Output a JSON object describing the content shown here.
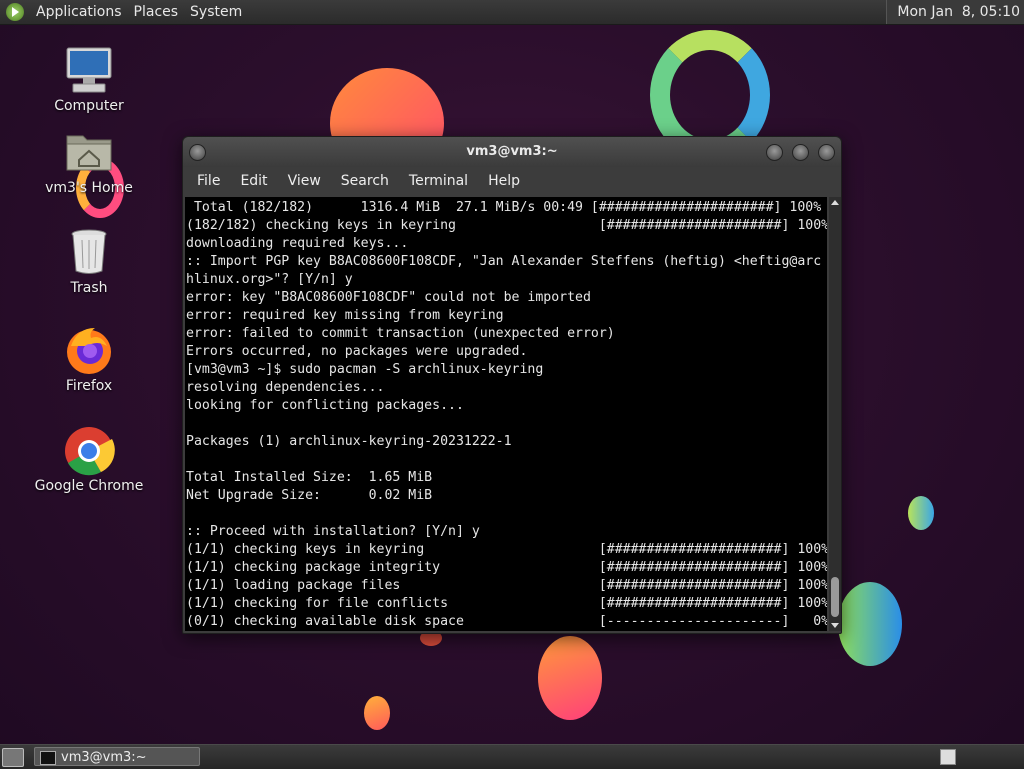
{
  "top_panel": {
    "menus": [
      "Applications",
      "Places",
      "System"
    ],
    "clock": "Mon Jan  8, 05:10"
  },
  "desktop_icons": [
    {
      "label": "Computer",
      "icon": "computer-icon"
    },
    {
      "label": "vm3's Home",
      "icon": "home-folder-icon"
    },
    {
      "label": "Trash",
      "icon": "trash-icon"
    },
    {
      "label": "Firefox",
      "icon": "firefox-icon"
    },
    {
      "label": "Google Chrome",
      "icon": "chrome-icon"
    }
  ],
  "terminal": {
    "title": "vm3@vm3:~",
    "menu": [
      "File",
      "Edit",
      "View",
      "Search",
      "Terminal",
      "Help"
    ],
    "lines": [
      " Total (182/182)      1316.4 MiB  27.1 MiB/s 00:49 [######################] 100%",
      "(182/182) checking keys in keyring                  [######################] 100%",
      "downloading required keys...",
      ":: Import PGP key B8AC08600F108CDF, \"Jan Alexander Steffens (heftig) <heftig@arc",
      "hlinux.org>\"? [Y/n] y",
      "error: key \"B8AC08600F108CDF\" could not be imported",
      "error: required key missing from keyring",
      "error: failed to commit transaction (unexpected error)",
      "Errors occurred, no packages were upgraded.",
      "[vm3@vm3 ~]$ sudo pacman -S archlinux-keyring",
      "resolving dependencies...",
      "looking for conflicting packages...",
      "",
      "Packages (1) archlinux-keyring-20231222-1",
      "",
      "Total Installed Size:  1.65 MiB",
      "Net Upgrade Size:      0.02 MiB",
      "",
      ":: Proceed with installation? [Y/n] y",
      "(1/1) checking keys in keyring                      [######################] 100%",
      "(1/1) checking package integrity                    [######################] 100%",
      "(1/1) loading package files                         [######################] 100%",
      "(1/1) checking for file conflicts                   [######################] 100%",
      "(0/1) checking available disk space                 [----------------------]   0%"
    ]
  },
  "taskbar": {
    "items": [
      "vm3@vm3:~"
    ]
  },
  "colors": {
    "desktop_bg": "#2b0e2c",
    "terminal_bg": "#000000",
    "terminal_fg": "#e6e6e6",
    "panel_bg": "#333333"
  }
}
